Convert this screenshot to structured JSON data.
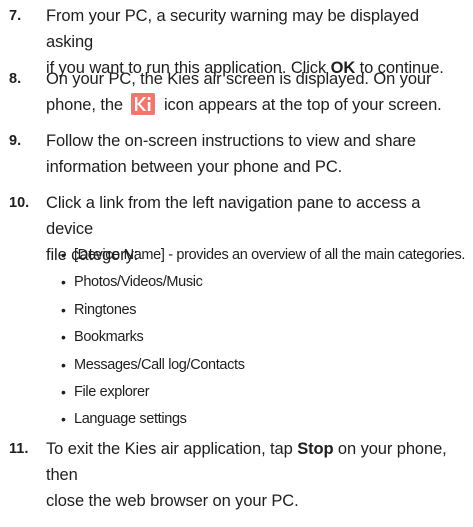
{
  "steps": [
    {
      "number": "7.",
      "line1_pre": "From your PC, a security warning may be displayed asking",
      "line2_pre": "if you want to run this application. Click ",
      "line2_bold": "OK",
      "line2_post": " to continue."
    },
    {
      "number": "8.",
      "line1": "On your PC, the Kies air screen is displayed. On your",
      "line2_pre": "phone, the",
      "icon_glyph": "K",
      "line2_post": "icon appears at the top of your screen.",
      "icon_name": "kies-air-icon",
      "icon_color": "#f2766c"
    },
    {
      "number": "9.",
      "line1": "Follow the on-screen instructions to view and share",
      "line2": "information between your phone and PC."
    },
    {
      "number": "10.",
      "line1": "Click a link from the left navigation pane to access a device",
      "line2": "file category:",
      "bullets": [
        "[Device Name] - provides an overview of all the main categories.",
        "Photos/Videos/Music",
        "Ringtones",
        "Bookmarks",
        "Messages/Call log/Contacts",
        "File explorer",
        "Language settings"
      ]
    },
    {
      "number": "11.",
      "line1_pre": "To exit the Kies air application, tap ",
      "line1_bold": "Stop",
      "line1_post": " on your phone, then",
      "line2": "close the web browser on your PC."
    }
  ],
  "bullet_glyph": "•"
}
